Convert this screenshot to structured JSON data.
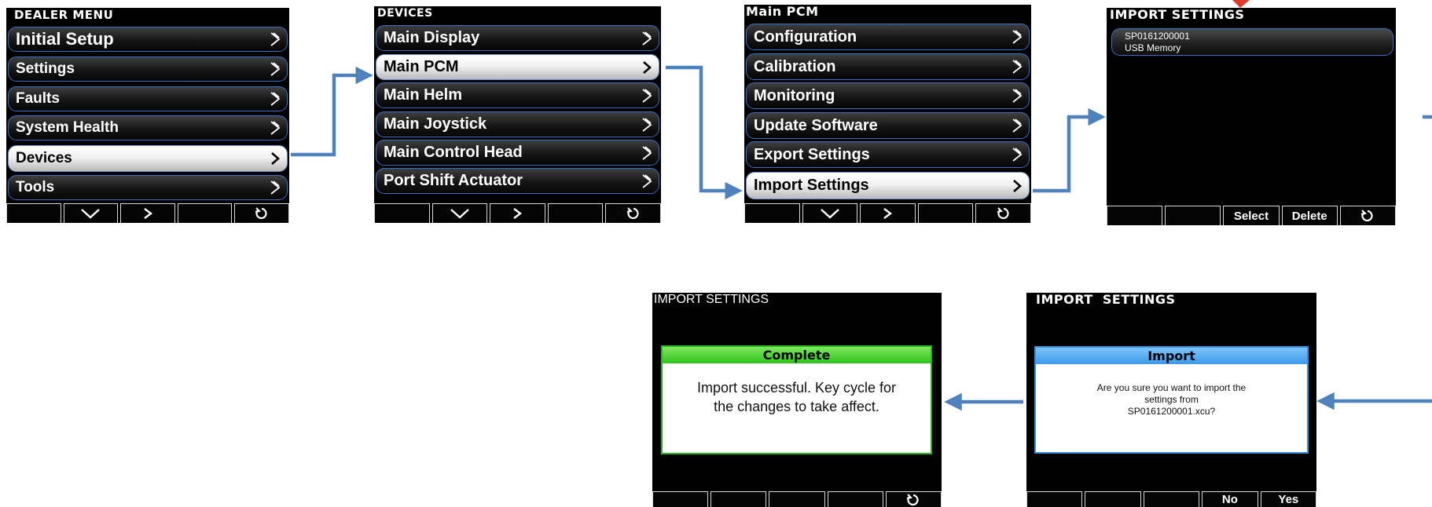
{
  "screens": {
    "dealer_menu": {
      "title": "DEALER MENU",
      "items": [
        "Initial Setup",
        "Settings",
        "Faults",
        "System Health",
        "Devices",
        "Tools"
      ],
      "selected": "Devices"
    },
    "devices": {
      "title": "DEVICES",
      "items": [
        "Main Display",
        "Main PCM",
        "Main Helm",
        "Main Joystick",
        "Main Control Head",
        "Port Shift Actuator"
      ],
      "selected": "Main PCM"
    },
    "main_pcm": {
      "title": "Main PCM",
      "items": [
        "Configuration",
        "Calibration",
        "Monitoring",
        "Update Software",
        "Export Settings",
        "Import Settings"
      ],
      "selected": "Import Settings"
    },
    "import_list": {
      "title": "IMPORT SETTINGS",
      "file_line1": "SP0161200001",
      "file_line2": "USB Memory",
      "softkeys": [
        "",
        "",
        "Select",
        "Delete",
        ""
      ]
    },
    "import_confirm": {
      "title": "IMPORT  SETTINGS",
      "dialog_title": "Import",
      "dialog_line1": "Are you sure you want to import the",
      "dialog_line2": "settings from",
      "dialog_line3": "SP0161200001.xcu?",
      "softkeys": [
        "",
        "",
        "",
        "No",
        "Yes"
      ]
    },
    "import_complete": {
      "title": "IMPORT SETTINGS",
      "dialog_title": "Complete",
      "dialog_line1": "Import successful. Key cycle for",
      "dialog_line2": "the changes to take affect."
    }
  },
  "colors": {
    "screen_bg": "#000000",
    "item_border": "#3b6fc0",
    "flow_arrow": "#4f81bd",
    "dialog_green": "#3fcf2b",
    "dialog_blue": "#4aa6ee",
    "accent_red": "#e03a2c"
  },
  "icons": {
    "chevron": "chevron-right-icon",
    "down": "chevron-down-icon",
    "back": "back-rotate-icon",
    "flow": "flow-arrow-icon"
  }
}
